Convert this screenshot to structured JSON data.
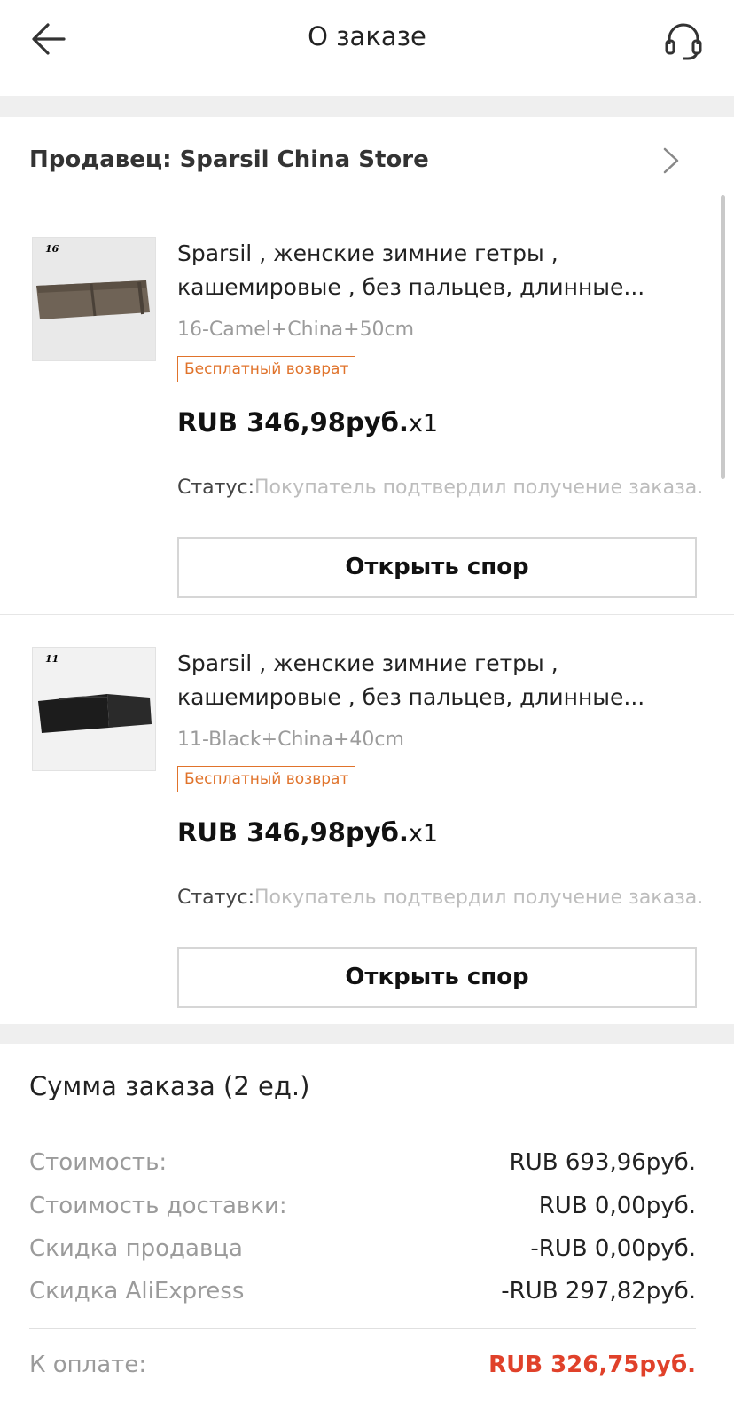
{
  "header": {
    "title": "О заказе",
    "back_icon": "arrow-left-icon",
    "support_icon": "headset-icon"
  },
  "seller": {
    "label": "Продавец: Sparsil China Store",
    "chevron_icon": "chevron-right-icon"
  },
  "items": [
    {
      "thumb_number": "16",
      "title_line1": "Sparsil , женские зимние гетры ,",
      "title_line2": "кашемировые , без пальцев, длинные...",
      "variant": "16-Camel+China+50cm",
      "badge": "Бесплатный возврат",
      "price": "RUB 346,98руб.",
      "quantity": "x1",
      "status_label": "Статус:",
      "status_value": "Покупатель подтвердил получение заказа.",
      "button": "Открыть спор",
      "thumb_color": "#6f6356"
    },
    {
      "thumb_number": "11",
      "title_line1": "Sparsil , женские зимние гетры ,",
      "title_line2": "кашемировые , без пальцев, длинные...",
      "variant": "11-Black+China+40cm",
      "badge": "Бесплатный возврат",
      "price": "RUB 346,98руб.",
      "quantity": "x1",
      "status_label": "Статус:",
      "status_value": "Покупатель подтвердил получение заказа.",
      "button": "Открыть спор",
      "thumb_color": "#1c1c1c"
    }
  ],
  "summary": {
    "title": "Сумма заказа (2 ед.)",
    "rows": [
      {
        "label": "Стоимость:",
        "value": "RUB 693,96руб."
      },
      {
        "label": "Стоимость доставки:",
        "value": "RUB 0,00руб."
      },
      {
        "label": "Скидка продавца",
        "value": "-RUB 0,00руб."
      },
      {
        "label": "Скидка AliExpress",
        "value": "-RUB 297,82руб."
      }
    ],
    "pay_label": "К оплате:",
    "pay_value": "RUB 326,75руб."
  },
  "colors": {
    "accent": "#e0412a",
    "badge": "#e0732b",
    "muted": "#9b9b9b"
  }
}
